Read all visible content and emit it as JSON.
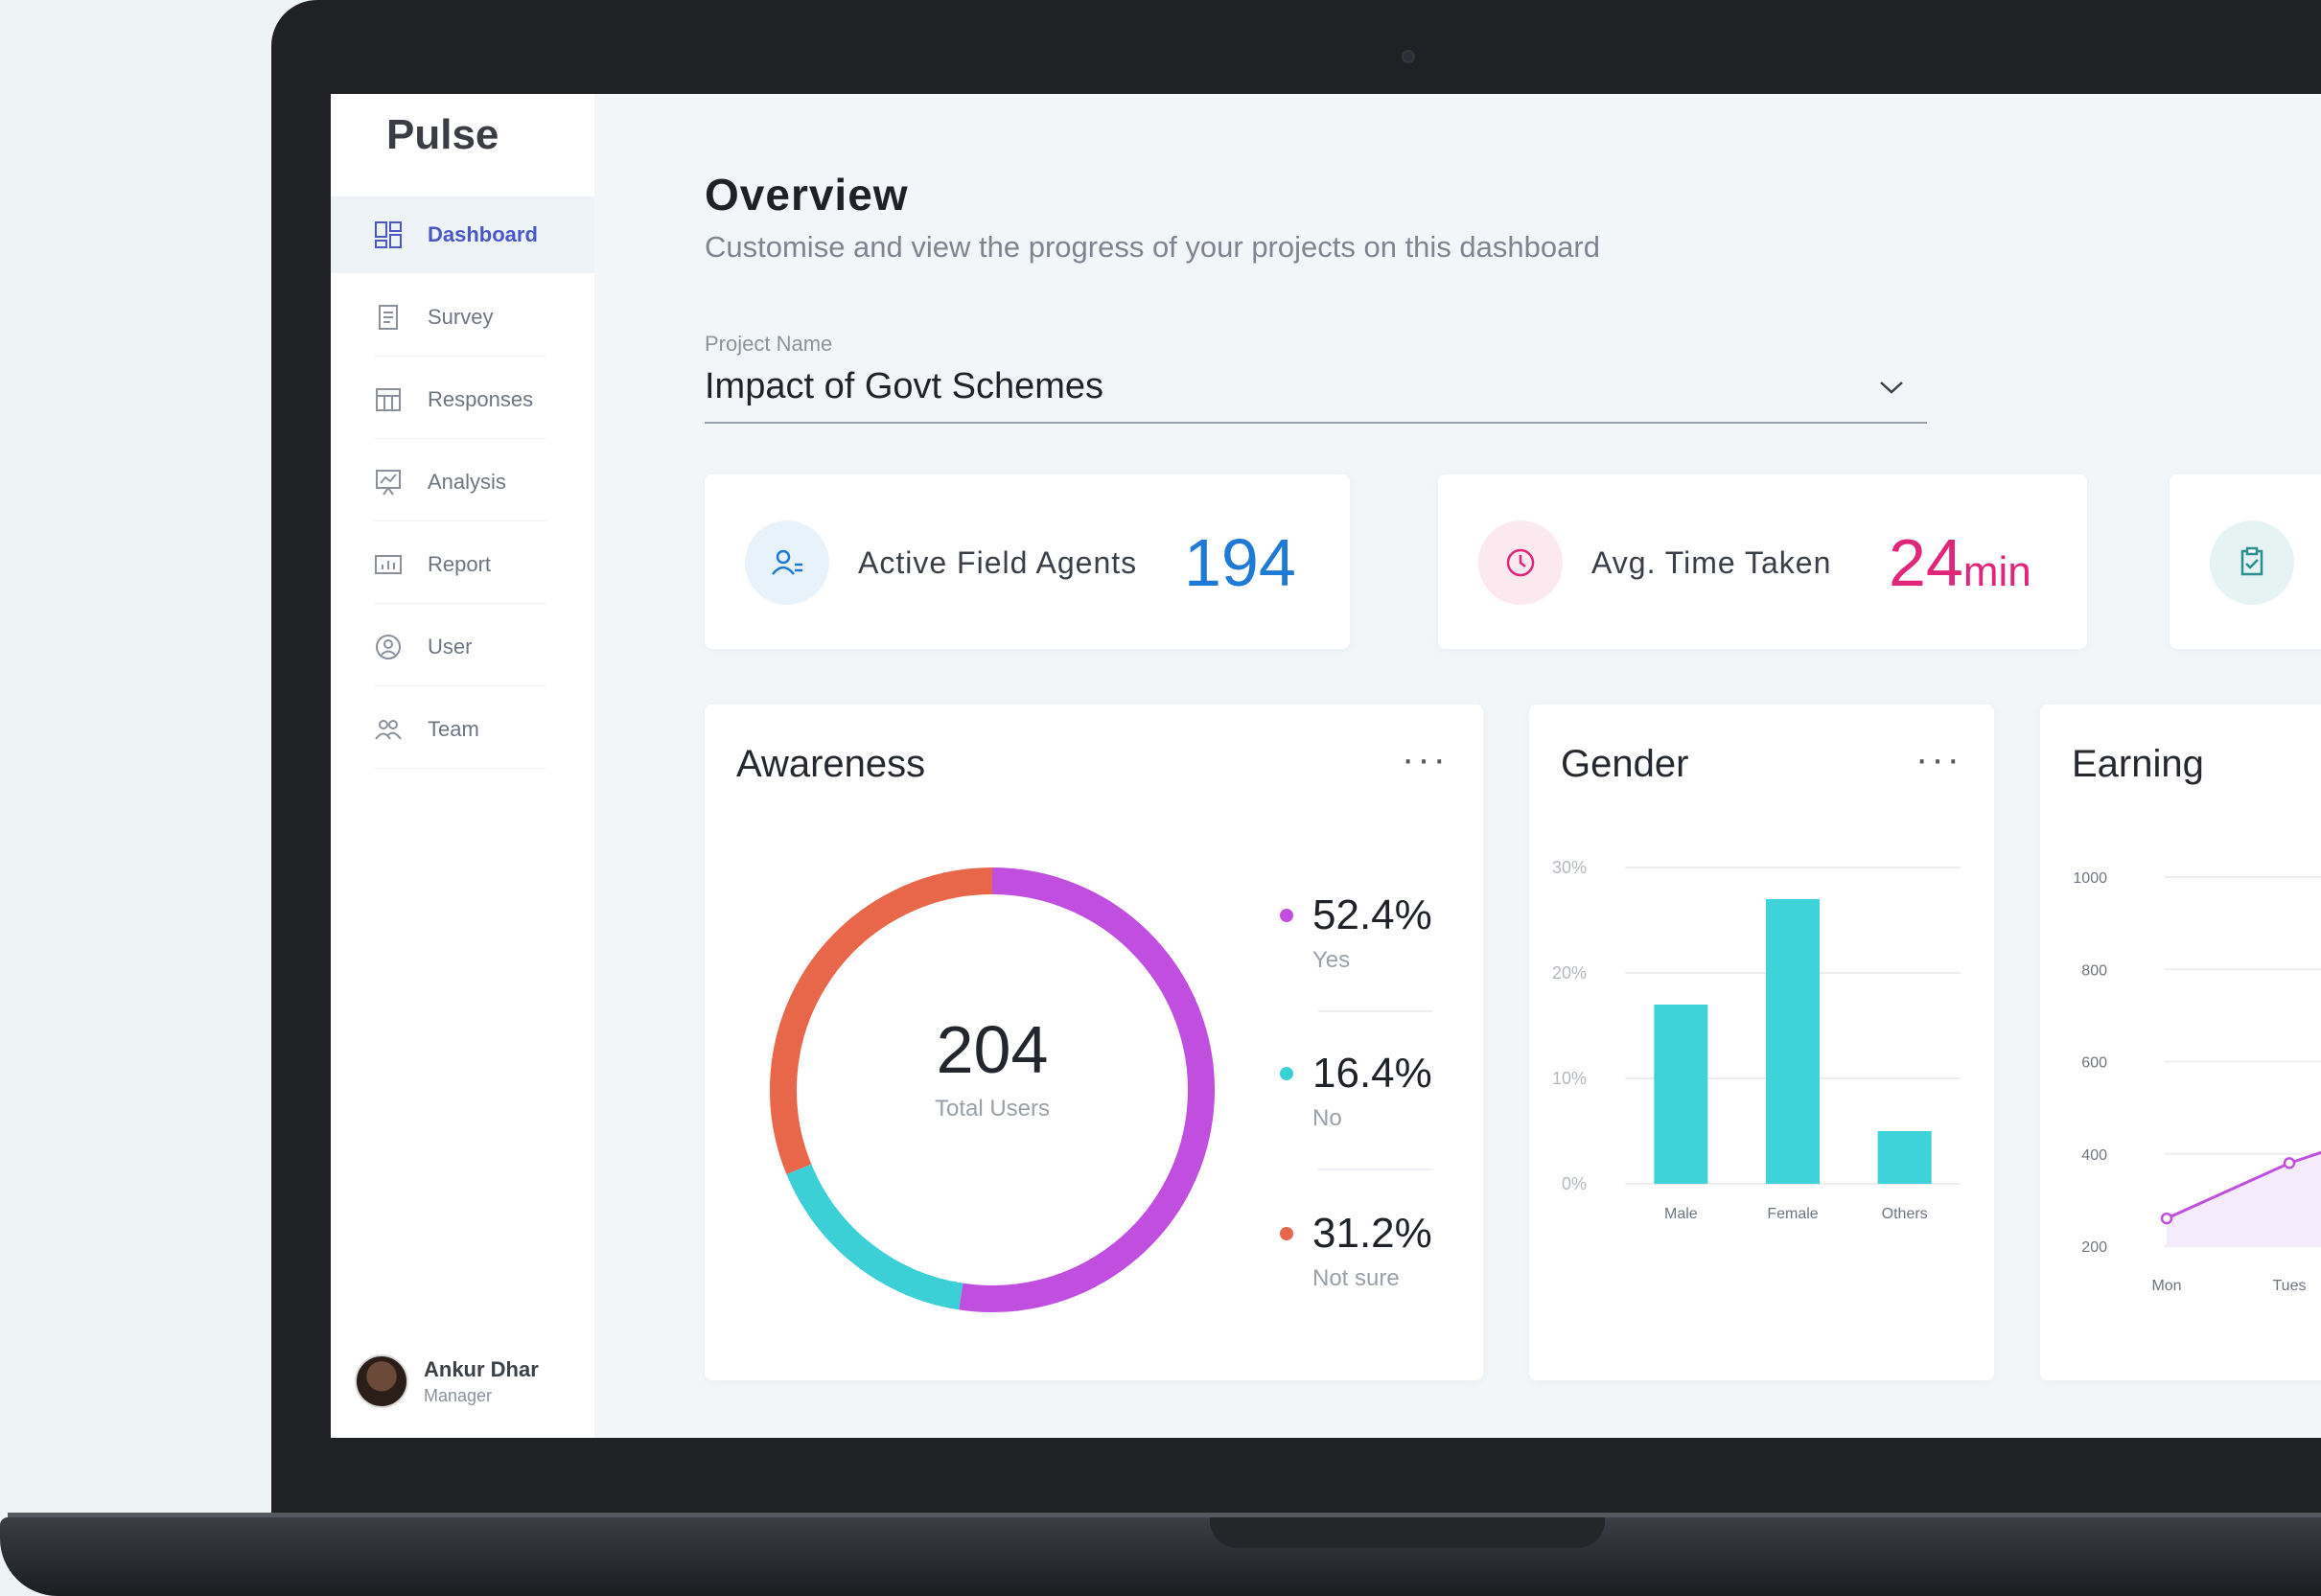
{
  "app": {
    "brand": "Pulse"
  },
  "sidebar": {
    "items": [
      {
        "label": "Dashboard",
        "icon": "dashboard-icon",
        "active": true
      },
      {
        "label": "Survey",
        "icon": "clipboard-icon"
      },
      {
        "label": "Responses",
        "icon": "responses-icon"
      },
      {
        "label": "Analysis",
        "icon": "analysis-icon"
      },
      {
        "label": "Report",
        "icon": "report-icon"
      },
      {
        "label": "User",
        "icon": "user-icon"
      },
      {
        "label": "Team",
        "icon": "team-icon"
      }
    ],
    "profile": {
      "name": "Ankur Dhar",
      "role": "Manager"
    }
  },
  "header": {
    "title": "Overview",
    "subtitle": "Customise and view the progress of your projects on this dashboard"
  },
  "project": {
    "label": "Project Name",
    "value": "Impact of Govt Schemes"
  },
  "stats": [
    {
      "label": "Active Field Agents",
      "value": "194",
      "color": "#1f7ad6",
      "icon": "agents-icon"
    },
    {
      "label": "Avg. Time Taken",
      "value": "24",
      "unit": "min",
      "color": "#e0267a",
      "icon": "clock-icon"
    }
  ],
  "colors": {
    "accent": "#4b57c9",
    "purple": "#c04fe0",
    "teal": "#3dcfd6",
    "orange": "#e8664a",
    "chart_teal": "#3dd3d8"
  },
  "awareness": {
    "title": "Awareness",
    "total_value": "204",
    "total_label": "Total Users",
    "legend": [
      {
        "pct": "52.4%",
        "name": "Yes",
        "color": "#c04fe0"
      },
      {
        "pct": "16.4%",
        "name": "No",
        "color": "#3dcfd6"
      },
      {
        "pct": "31.2%",
        "name": "Not sure",
        "color": "#e8664a"
      }
    ]
  },
  "gender": {
    "title": "Gender"
  },
  "earning": {
    "title": "Earning"
  },
  "chart_data": [
    {
      "type": "pie",
      "title": "Awareness",
      "categories": [
        "Yes",
        "No",
        "Not sure"
      ],
      "values": [
        52.4,
        16.4,
        31.2
      ]
    },
    {
      "type": "bar",
      "title": "Gender",
      "categories": [
        "Male",
        "Female",
        "Others"
      ],
      "values": [
        17,
        27,
        5
      ],
      "yticks": [
        "0%",
        "10%",
        "20%",
        "30%"
      ],
      "ylim": [
        0,
        30
      ],
      "grid": true
    },
    {
      "type": "line",
      "title": "Earning",
      "x": [
        "Mon",
        "Tues"
      ],
      "values": [
        260,
        380
      ],
      "yticks": [
        "200",
        "400",
        "600",
        "800",
        "1000"
      ],
      "ylim": [
        200,
        1000
      ],
      "grid": true
    }
  ]
}
